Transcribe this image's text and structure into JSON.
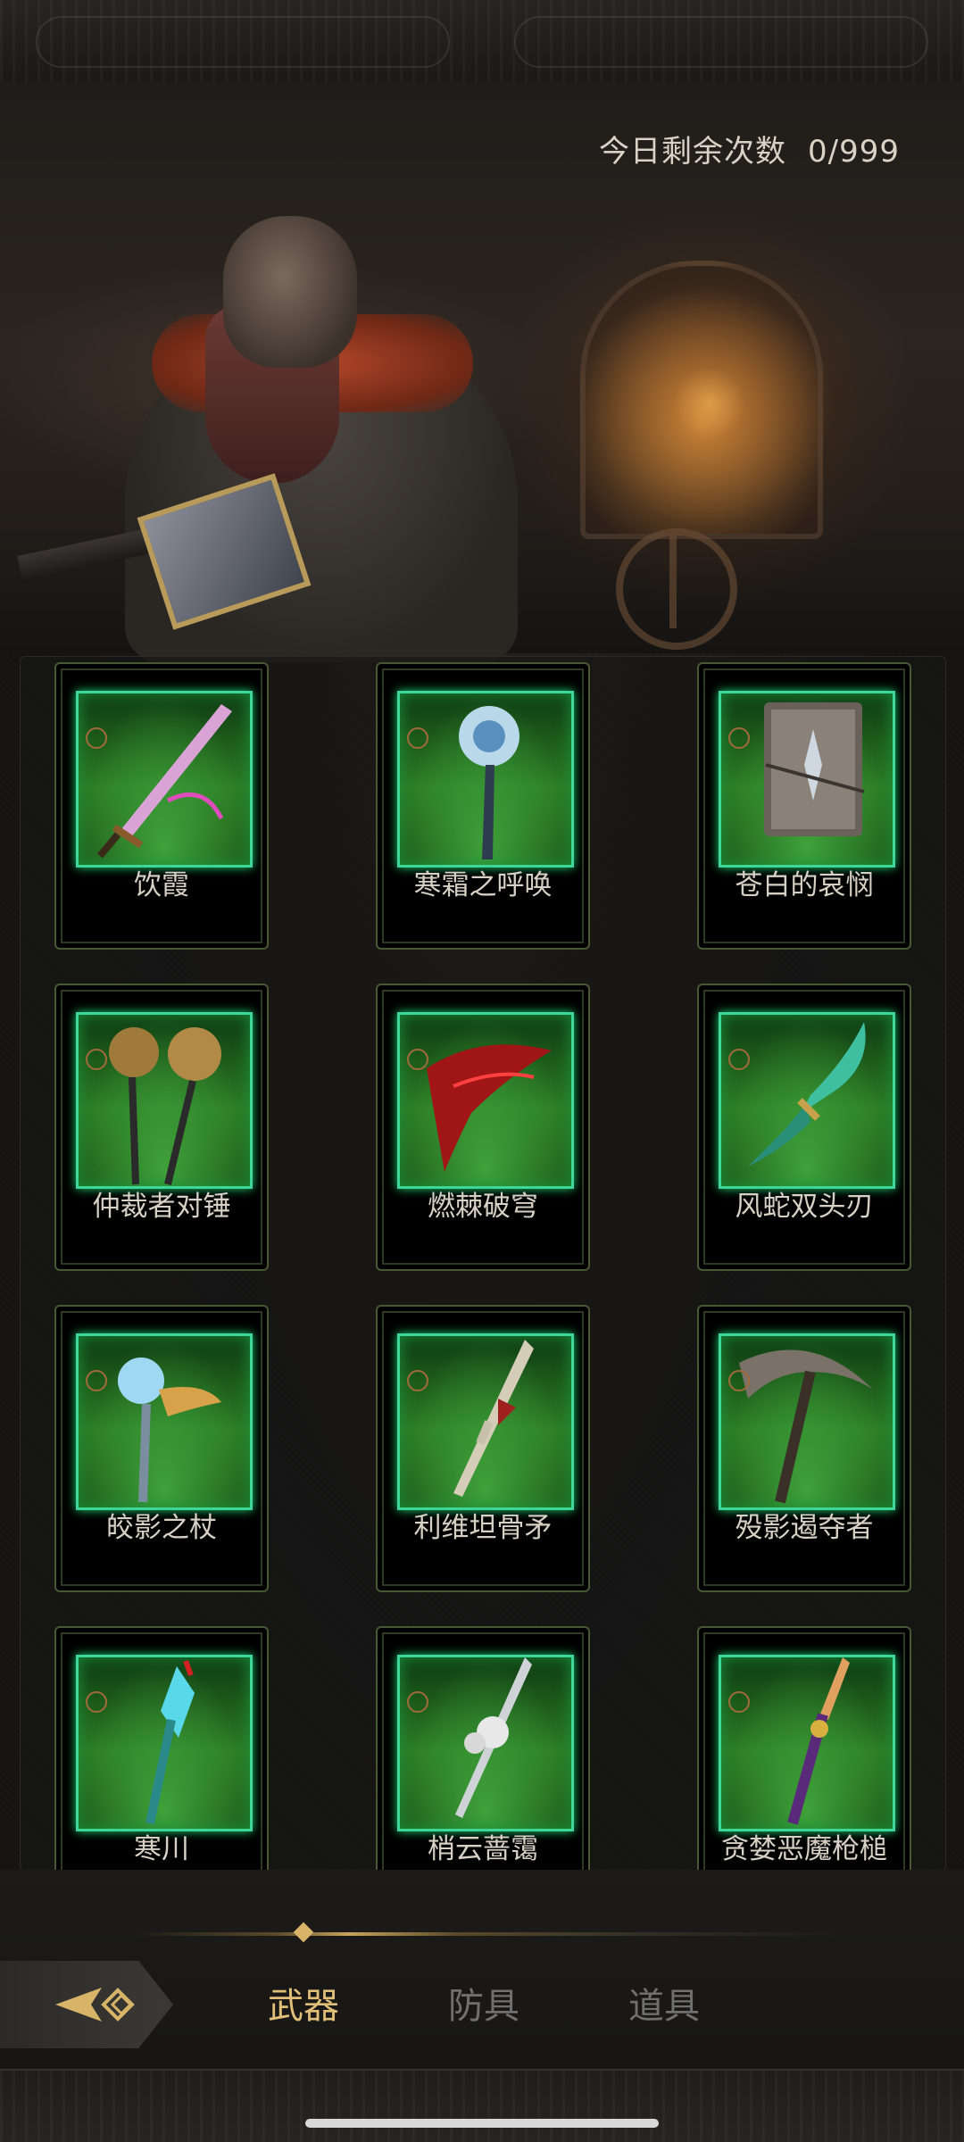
{
  "counter": {
    "label": "今日剩余次数",
    "value": "0/999"
  },
  "items": [
    {
      "name": "饮霞",
      "icon": "sword-icon"
    },
    {
      "name": "寒霜之呼唤",
      "icon": "frost-staff-icon"
    },
    {
      "name": "苍白的哀悯",
      "icon": "spellbook-icon"
    },
    {
      "name": "仲裁者对锤",
      "icon": "twin-mace-icon"
    },
    {
      "name": "燃棘破穹",
      "icon": "crimson-blade-icon"
    },
    {
      "name": "风蛇双头刃",
      "icon": "curved-dagger-icon"
    },
    {
      "name": "皎影之杖",
      "icon": "dragon-staff-icon"
    },
    {
      "name": "利维坦骨矛",
      "icon": "bone-spear-icon"
    },
    {
      "name": "殁影遏夺者",
      "icon": "scythe-axe-icon"
    },
    {
      "name": "寒川",
      "icon": "ice-scepter-icon"
    },
    {
      "name": "梢云蔷霭",
      "icon": "rose-spear-icon"
    },
    {
      "name": "贪婪恶魔枪槌",
      "icon": "demon-lance-icon"
    }
  ],
  "tabs": [
    {
      "label": "武器",
      "active": true
    },
    {
      "label": "防具",
      "active": false
    },
    {
      "label": "道具",
      "active": false
    }
  ],
  "colors": {
    "accent": "#e1bf79",
    "frame_green": "#3fd69a",
    "inactive_tab": "#707070"
  }
}
